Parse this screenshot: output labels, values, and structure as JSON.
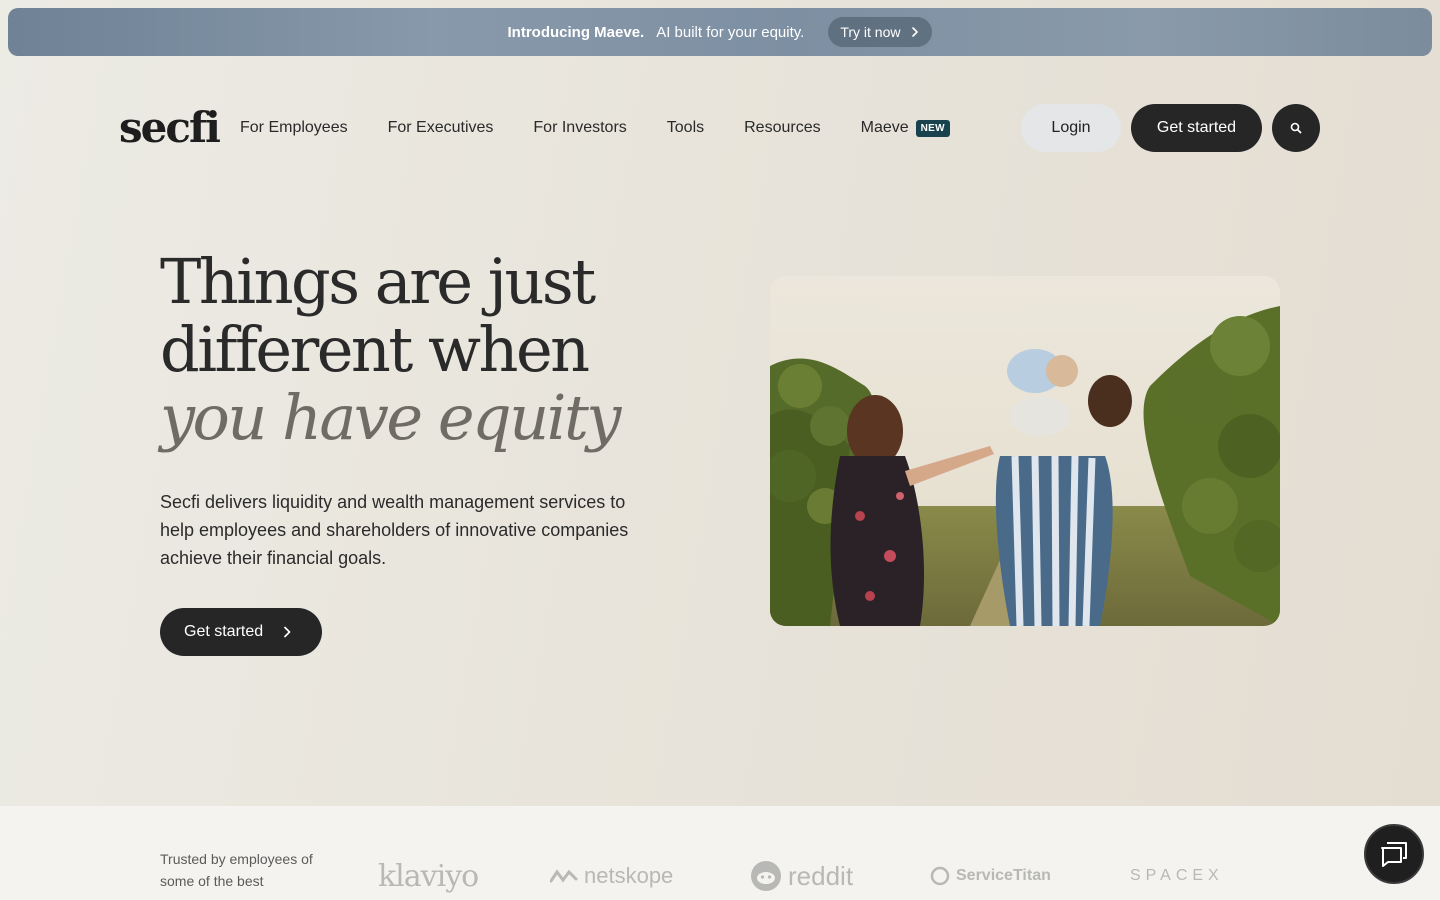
{
  "announcement": {
    "intro": "Introducing Maeve.",
    "tagline": "AI built for your equity.",
    "cta": "Try it now"
  },
  "nav": {
    "logo": "secfi",
    "links": [
      "For Employees",
      "For Executives",
      "For Investors",
      "Tools",
      "Resources",
      "Maeve"
    ],
    "new_badge": "NEW",
    "login": "Login",
    "get_started": "Get started"
  },
  "hero": {
    "headline_line1": "Things are just",
    "headline_line2": "different when",
    "headline_line3": "you have equity",
    "description": "Secfi delivers liquidity and wealth management services to help employees and shareholders of innovative companies achieve their financial goals.",
    "cta": "Get started"
  },
  "trusted": {
    "text": "Trusted by employees of some of the best",
    "logos": [
      "klaviyo",
      "netskope",
      "reddit",
      "ServiceTitan",
      "SPACEX"
    ]
  },
  "colors": {
    "dark_button": "#262626",
    "badge": "#18424d",
    "announcement_bg": "#7d8fa2"
  }
}
